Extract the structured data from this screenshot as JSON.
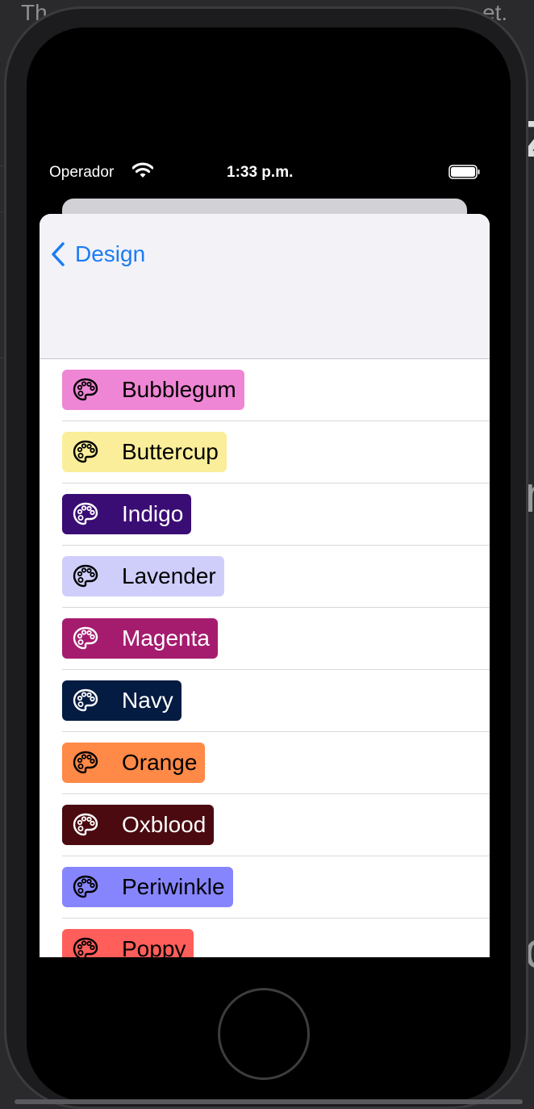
{
  "background": {
    "top_text_left": "Th",
    "top_text_right": "et."
  },
  "status_bar": {
    "carrier": "Operador",
    "time": "1:33 p.m."
  },
  "nav": {
    "back_label": "Design"
  },
  "colors": [
    {
      "name": "Bubblegum",
      "bg": "#ef86d5",
      "fg": "#000000"
    },
    {
      "name": "Buttercup",
      "bg": "#fbee9a",
      "fg": "#000000"
    },
    {
      "name": "Indigo",
      "bg": "#3a0d75",
      "fg": "#ffffff"
    },
    {
      "name": "Lavender",
      "bg": "#cfcefb",
      "fg": "#000000"
    },
    {
      "name": "Magenta",
      "bg": "#a51c6f",
      "fg": "#ffffff"
    },
    {
      "name": "Navy",
      "bg": "#041b42",
      "fg": "#ffffff"
    },
    {
      "name": "Orange",
      "bg": "#ff8947",
      "fg": "#000000"
    },
    {
      "name": "Oxblood",
      "bg": "#4a0a0f",
      "fg": "#ffffff"
    },
    {
      "name": "Periwinkle",
      "bg": "#8685fe",
      "fg": "#000000"
    },
    {
      "name": "Poppy",
      "bg": "#ff5e5a",
      "fg": "#000000"
    }
  ],
  "icons": {
    "palette": "palette-icon",
    "back": "chevron-left-icon",
    "wifi": "wifi-icon",
    "battery": "battery-icon"
  }
}
